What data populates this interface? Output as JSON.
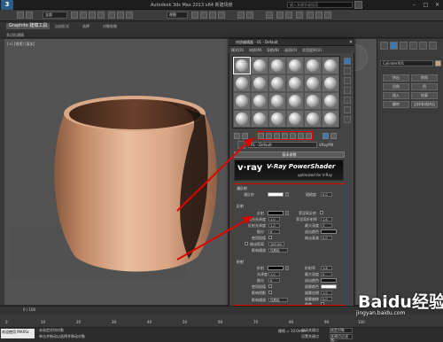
{
  "app": {
    "logo": "3",
    "title": "Autodesk 3ds Max 2013 x64     新建场景",
    "search_placeholder": "键入关键字或短语",
    "workspace": "工作台: 默认"
  },
  "toolbar": {
    "selection_filter": "全部",
    "view_dropdown": "视图"
  },
  "ribbon": {
    "tabs": [
      "Graphite 建模工具",
      "自由形式",
      "选择",
      "对象绘制"
    ],
    "sub_label": "多边形建模"
  },
  "viewport": {
    "label": "[+] [透视] [真实]"
  },
  "material_editor": {
    "title": "材质编辑器 - 01 - Default",
    "menu": [
      "模式(D)",
      "材质(M)",
      "导航(N)",
      "选项(O)",
      "实用程序(U)"
    ],
    "material_name": "01 - Default",
    "material_type": "VRayMtl",
    "rollout_basic": "基本参数",
    "vray_logo": "v·ray",
    "vray_title": "V-Ray PowerShader",
    "vray_subtitle": "optimized for V-Ray",
    "diffuse": {
      "section": "漫反射",
      "diffuse_label": "漫反射",
      "roughness_label": "粗糙度",
      "roughness_value": "0.0"
    },
    "reflection": {
      "section": "反射",
      "reflect_label": "反射",
      "hilight_gloss_label": "高光光泽度",
      "hilight_gloss_value": "1.0",
      "refl_gloss_label": "反射光泽度",
      "refl_gloss_value": "1.0",
      "subdivs_label": "细分",
      "subdivs_value": "8",
      "use_interp_label": "使用插值",
      "dim_distance_label": "暗淡距离",
      "dim_distance_value": "100.0m",
      "affect_channels_label": "影响通道",
      "affect_channels_value": "仅颜色",
      "fresnel_label": "菲涅耳反射",
      "fresnel_ior_label": "菲涅耳折射率",
      "fresnel_ior_value": "1.6",
      "max_depth_label": "最大深度",
      "max_depth_value": "5",
      "exit_color_label": "退出颜色",
      "dim_falloff_label": "暗淡衰减",
      "dim_falloff_value": "0.0"
    },
    "refraction": {
      "section": "折射",
      "refract_label": "折射",
      "ior_label": "折射率",
      "ior_value": "1.6",
      "gloss_label": "光泽度",
      "gloss_value": "1.0",
      "max_depth_label": "最大深度",
      "max_depth_value": "5",
      "subdivs_label": "细分",
      "subdivs_value": "8",
      "exit_color_label": "退出颜色",
      "use_interp_label": "使用插值",
      "fog_color_label": "烟雾颜色",
      "affect_shadows_label": "影响阴影",
      "fog_mult_label": "烟雾倍增",
      "fog_mult_value": "1.0",
      "affect_channels_label": "影响通道",
      "affect_channels_value": "仅颜色",
      "fog_bias_label": "烟雾偏移",
      "fog_bias_value": "0.0",
      "dispersion_label": "色散"
    }
  },
  "right_panel": {
    "object_name": "Cylinder001",
    "buttons": [
      "挤出",
      "倒角",
      "切角",
      "桥",
      "插入",
      "轮廓",
      "翻转",
      "沿样条线挤出"
    ]
  },
  "timeline": {
    "position": "0 / 100",
    "ticks": [
      "0",
      "10",
      "20",
      "30",
      "40",
      "50",
      "60",
      "70",
      "80",
      "90",
      "100"
    ]
  },
  "status": {
    "maxscript": "欢迎使用 MAXSc",
    "line1": "未选定任何对象",
    "line2": "单击并拖动以选择并移动对象",
    "grid": "栅格 = 10.0mm",
    "autokey": "自动关键点",
    "selected": "选定对象",
    "setkey": "设置关键点",
    "keyfilter": "关键点过滤器..."
  },
  "watermark": {
    "text": "Baidu经验",
    "sub": "jingyan.baidu.com"
  },
  "colors": {
    "highlight": "#e00000",
    "vase": "#d8a887",
    "viewport_bg": "#535353"
  }
}
